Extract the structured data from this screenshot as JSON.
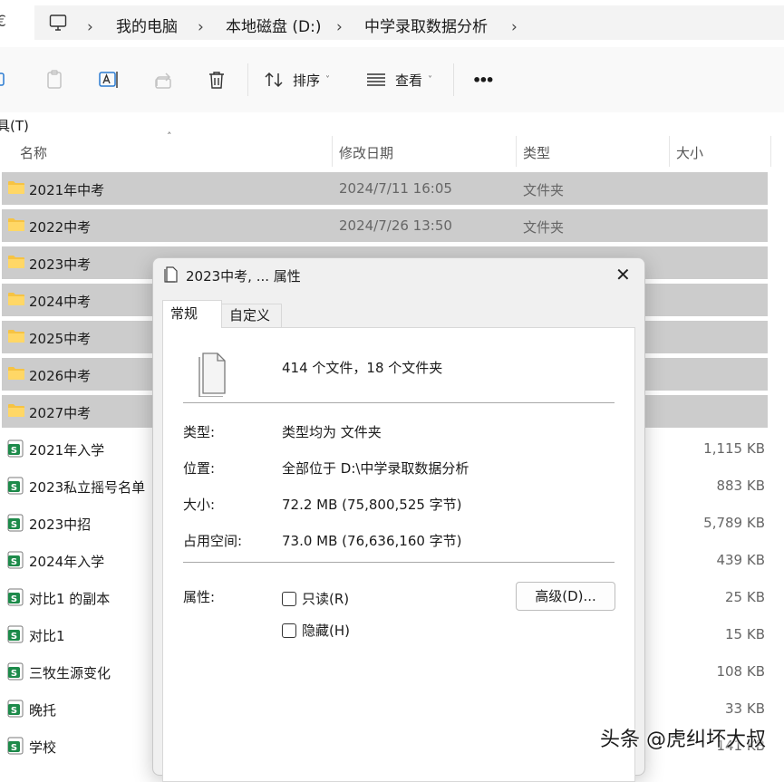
{
  "address_bar": {
    "edge_glyph": "€",
    "crumbs": [
      "我的电脑",
      "本地磁盘 (D:)",
      "中学录取数据分析"
    ],
    "separator": "›"
  },
  "toolbar": {
    "sort_label": "排序",
    "view_label": "查看",
    "more_label": "•••",
    "caret": "˅"
  },
  "menu": {
    "tools_label": "具(T)"
  },
  "columns": {
    "name": "名称",
    "modified": "修改日期",
    "type": "类型",
    "size": "大小",
    "sort_indicator": "˄"
  },
  "files": [
    {
      "name": "2021年中考",
      "date": "2024/7/11 16:05",
      "type": "文件夹",
      "size": "",
      "kind": "folder",
      "selected": true
    },
    {
      "name": "2022中考",
      "date": "2024/7/26 13:50",
      "type": "文件夹",
      "size": "",
      "kind": "folder",
      "selected": true
    },
    {
      "name": "2023中考",
      "date": "",
      "type": "",
      "size": "",
      "kind": "folder",
      "selected": true
    },
    {
      "name": "2024中考",
      "date": "",
      "type": "",
      "size": "",
      "kind": "folder",
      "selected": true
    },
    {
      "name": "2025中考",
      "date": "",
      "type": "",
      "size": "",
      "kind": "folder",
      "selected": true
    },
    {
      "name": "2026中考",
      "date": "",
      "type": "",
      "size": "",
      "kind": "folder",
      "selected": true
    },
    {
      "name": "2027中考",
      "date": "",
      "type": "",
      "size": "",
      "kind": "folder",
      "selected": true
    },
    {
      "name": "2021年入学",
      "date": "",
      "type": "",
      "size": "1,115 KB",
      "kind": "sheet",
      "selected": false
    },
    {
      "name": "2023私立摇号名单",
      "date": "",
      "type": "",
      "size": "883 KB",
      "kind": "sheet",
      "selected": false
    },
    {
      "name": "2023中招",
      "date": "",
      "type": "",
      "size": "5,789 KB",
      "kind": "sheet",
      "selected": false
    },
    {
      "name": "2024年入学",
      "date": "",
      "type": "",
      "size": "439 KB",
      "kind": "sheet",
      "selected": false
    },
    {
      "name": "对比1 的副本",
      "date": "",
      "type": "",
      "size": "25 KB",
      "kind": "sheet",
      "selected": false
    },
    {
      "name": "对比1",
      "date": "",
      "type": "",
      "size": "15 KB",
      "kind": "sheet",
      "selected": false
    },
    {
      "name": "三牧生源变化",
      "date": "",
      "type": "",
      "size": "108 KB",
      "kind": "sheet",
      "selected": false
    },
    {
      "name": "晚托",
      "date": "",
      "type": "",
      "size": "33 KB",
      "kind": "sheet",
      "selected": false
    },
    {
      "name": "学校",
      "date": "",
      "type": "",
      "size": "141 KB",
      "kind": "sheet",
      "selected": false
    }
  ],
  "dialog": {
    "title": "2023中考, ... 属性",
    "close": "✕",
    "tabs": [
      "常规",
      "自定义"
    ],
    "summary": "414 个文件，18 个文件夹",
    "type_label": "类型:",
    "type_value": "类型均为 文件夹",
    "location_label": "位置:",
    "location_value": "全部位于 D:\\中学录取数据分析",
    "size_label": "大小:",
    "size_value": "72.2 MB (75,800,525 字节)",
    "disk_label": "占用空间:",
    "disk_value": "73.0 MB (76,636,160 字节)",
    "attr_label": "属性:",
    "readonly_label": "只读(R)",
    "hidden_label": "隐藏(H)",
    "advanced_label": "高级(D)..."
  },
  "watermark": "头条 @虎纠坏大叔",
  "colors": {
    "selection": "#cccccc",
    "folder": "#f6c343",
    "sheet": "#1d8a4a"
  }
}
